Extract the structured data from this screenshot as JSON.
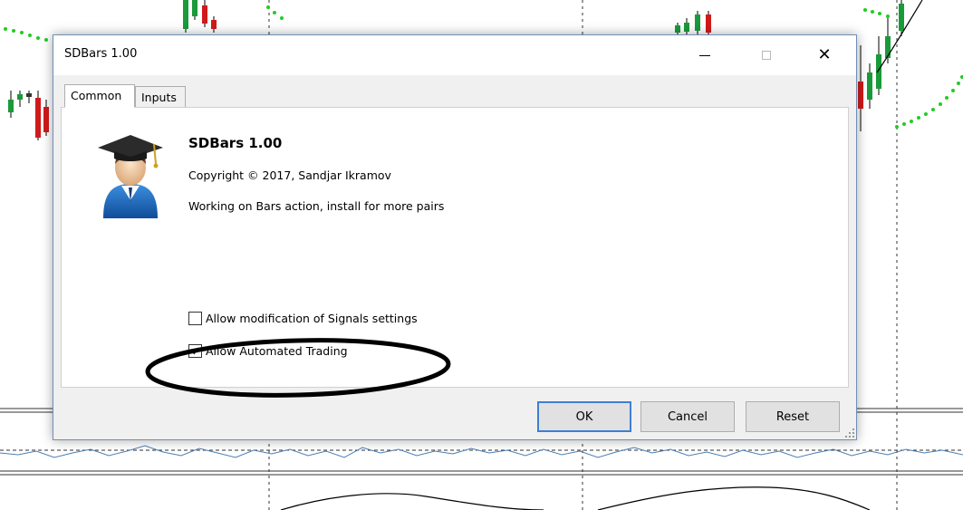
{
  "dialog": {
    "title": "SDBars 1.00",
    "window_controls": {
      "minimize_icon": "minimize-icon",
      "maximize_icon": "maximize-icon",
      "close_icon": "close-icon",
      "close_glyph": "✕"
    },
    "tabs": [
      {
        "label": "Common",
        "active": true
      },
      {
        "label": "Inputs",
        "active": false
      }
    ],
    "program": {
      "icon": "graduate-avatar-icon",
      "name": "SDBars 1.00",
      "copyright": "Copyright © 2017, Sandjar Ikramov",
      "description": "Working on Bars action, install for more pairs"
    },
    "options": [
      {
        "label": "Allow modification of Signals settings",
        "checked": false
      },
      {
        "label": "Allow Automated Trading",
        "checked": true
      }
    ],
    "buttons": {
      "ok": "OK",
      "cancel": "Cancel",
      "reset": "Reset"
    }
  },
  "colors": {
    "bull_candle": "#1a9a3a",
    "bear_candle": "#d01a1a",
    "dots": "#22cc22",
    "line": "#4a7fb5",
    "dialog_border": "#6f8fb6",
    "ok_focus": "#3f7fd5"
  }
}
